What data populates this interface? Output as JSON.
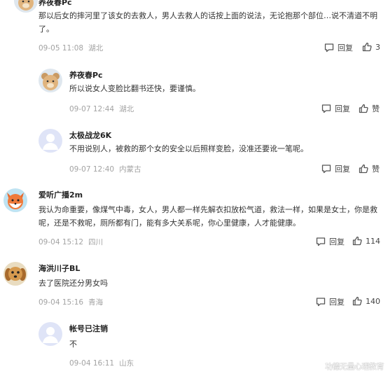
{
  "comments": [
    {
      "name": "养夜春Pc",
      "text": "那以后女的摔河里了该女的去救人，男人去救人的话按上面的说法，无论抱那个部位…说不清道不明了。",
      "date": "09-05 11:08",
      "location": "湖北",
      "reply_label": "回复",
      "like_count": "3",
      "avatar_icon": "cartoon-bear-avatar"
    },
    {
      "name": "养夜春Pc",
      "text": "所以说女人变脸比翻书还快，要谨慎。",
      "date": "09-07 12:44",
      "location": "湖北",
      "reply_label": "回复",
      "like_count": "赞",
      "avatar_icon": "cartoon-bear-avatar"
    },
    {
      "name": "太极战龙6K",
      "text": "不用说别人，被救的那个女的安全以后照样变脸，没准还要讹一笔呢。",
      "date": "09-07 12:40",
      "location": "内蒙古",
      "reply_label": "回复",
      "like_count": "赞",
      "avatar_icon": "default-user-avatar"
    },
    {
      "name": "爱听广播2m",
      "text": "我认为命重要，像煤气中毒，女人，男人都一样先解衣扣放松气道，救法一样，如果是女士，你是救呢，还是不救呢，厕所都有门，能有多大关系呢，你心里健康，人才能健康。",
      "date": "09-04 15:12",
      "location": "四川",
      "reply_label": "回复",
      "like_count": "114",
      "avatar_icon": "cartoon-fox-avatar"
    },
    {
      "name": "海洪川子BL",
      "text": "去了医院还分男女吗",
      "date": "09-04 15:16",
      "location": "青海",
      "reply_label": "回复",
      "like_count": "140",
      "avatar_icon": "dog-photo-avatar"
    },
    {
      "name": "帐号已注销",
      "text": "不",
      "date": "09-04 16:11",
      "location": "山东",
      "reply_label": "回复",
      "like_count": "赞",
      "avatar_icon": "default-user-avatar"
    }
  ],
  "watermark": "功德无量心理教育",
  "colors": {
    "meta": "#a3a3a3",
    "text": "#333333",
    "name": "#222222",
    "default_avatar_bg": "#dfe4f7"
  }
}
